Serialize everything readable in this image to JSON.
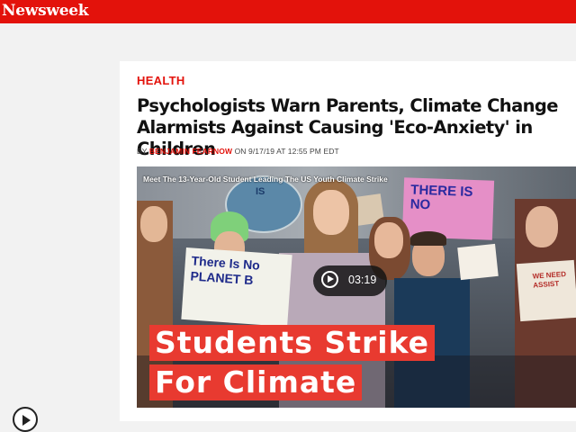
{
  "brand": {
    "logo_text": "Newsweek",
    "color": "#e3120b"
  },
  "article": {
    "section": "HEALTH",
    "headline": "Psychologists Warn Parents, Climate Change Alarmists Against Causing 'Eco-Anxiety' in Children",
    "byline": {
      "prefix": "BY",
      "author": "BENJAMIN FEARNOW",
      "date_prefix": "ON",
      "date": "9/17/19 AT 12:55 PM EDT"
    }
  },
  "video": {
    "title": "Meet The 13-Year-Old Student Leading The US Youth Climate Strike",
    "duration": "03:19",
    "banner_line1": "Students Strike",
    "banner_line2": "For Climate",
    "signs": {
      "sign_top_left": "IS",
      "sign_planet": "There Is No PLANET B",
      "sign_pink": "THERE IS NO",
      "sign_right": "WE NEED ASSIST"
    }
  },
  "icons": {
    "play": "play-icon",
    "corner_play": "play-circle-icon"
  }
}
